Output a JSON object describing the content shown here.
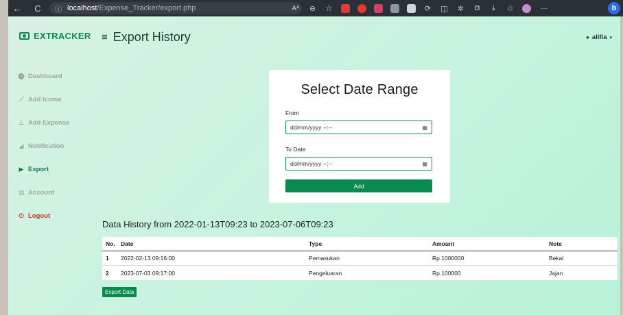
{
  "browser": {
    "url_host": "localhost",
    "url_path": "/Expense_Tracker/export.php",
    "back_icon": "←",
    "refresh_icon": "C",
    "info_icon": "ⓘ",
    "reader_icon": "Aᴬ",
    "more_icon": "···",
    "bing_label": "b"
  },
  "brand": {
    "name": "EXTRACKER"
  },
  "sidebar": {
    "items": [
      {
        "icon": "⓿",
        "label": "Dashboard"
      },
      {
        "icon": "⟋",
        "label": "Add Icome"
      },
      {
        "icon": "⊥",
        "label": "Add Expense"
      },
      {
        "icon": "◢",
        "label": "Notification"
      },
      {
        "icon": "▶",
        "label": "Export"
      },
      {
        "icon": "▤",
        "label": "Account"
      },
      {
        "icon": "⏻",
        "label": "Logout"
      }
    ]
  },
  "header": {
    "menu_icon": "≡",
    "title": "Export History",
    "user_icon": "●",
    "username": "alifia",
    "caret": "▾"
  },
  "form": {
    "title": "Select Date Range",
    "from_label": "From",
    "from_value": "dd/mm/yyyy --:--",
    "to_label": "To Date",
    "to_value": "dd/mm/yyyy --:--",
    "calendar_icon": "▦",
    "add_label": "Add"
  },
  "history": {
    "title": "Data History from 2022-01-13T09:23 to 2023-07-06T09:23",
    "columns": [
      "No.",
      "Date",
      "Type",
      "Amount",
      "Note"
    ],
    "rows": [
      [
        "1",
        "2022-02-13 09:16:00",
        "Pemasukan",
        "Rp.1000000",
        "Bekal"
      ],
      [
        "2",
        "2023-07-03 09:17:00",
        "Pengeluaran",
        "Rp.100000",
        "Jajan"
      ]
    ],
    "export_label": "Export Data"
  },
  "colors": {
    "brand_green": "#0a8a4f",
    "logout_red": "#d63026",
    "sidebar_muted": "#9da7a1"
  }
}
